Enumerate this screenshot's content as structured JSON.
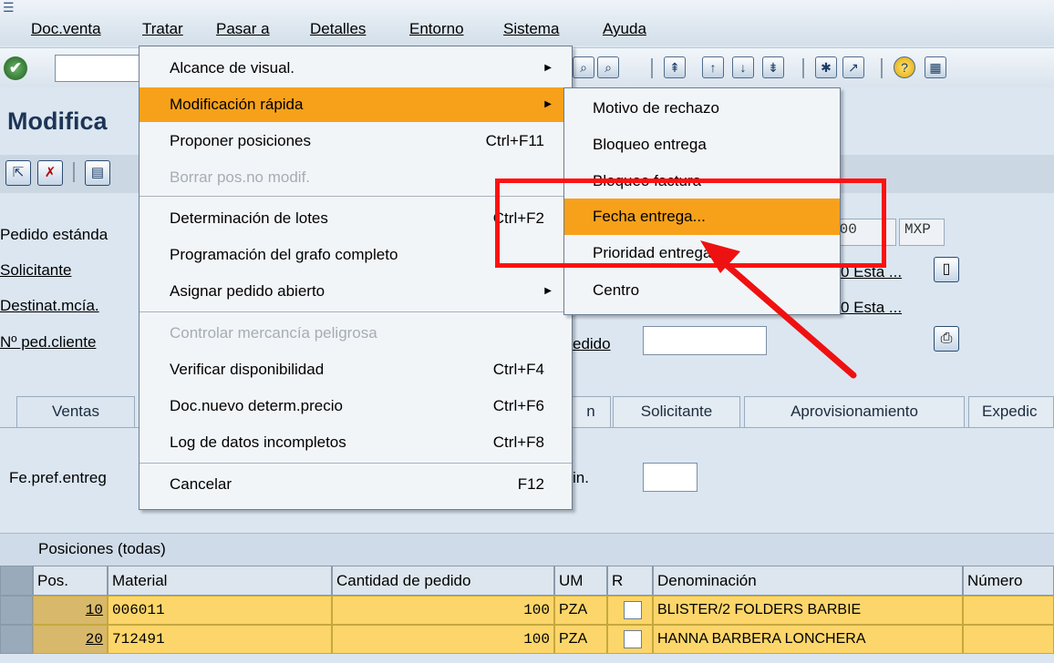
{
  "menubar": {
    "items": [
      "Doc.venta",
      "Tratar",
      "Pasar a",
      "Detalles",
      "Entorno",
      "Sistema",
      "Ayuda"
    ]
  },
  "title": "Modifica",
  "header": {
    "fields": [
      {
        "label": "Pedido estánda",
        "link": false
      },
      {
        "label": "Solicitante",
        "link": true
      },
      {
        "label": "Destinat.mcía.",
        "link": true
      },
      {
        "label": "Nº ped.cliente",
        "link": true
      }
    ],
    "net_value_frag": ".00",
    "currency": "MXP",
    "esta_1": "0 Esta ...",
    "esta_2": "0 Esta ...",
    "fecha_pedido_frag": "edido"
  },
  "tabs": [
    "Ventas",
    "n",
    "Solicitante",
    "Aprovisionamiento",
    "Expedic"
  ],
  "tab_panel": {
    "fe_pref_label": "Fe.pref.entreg",
    "in_label": "in."
  },
  "items": {
    "title": "Posiciones (todas)",
    "columns": [
      "Pos.",
      "Material",
      "Cantidad de pedido",
      "UM",
      "R",
      "Denominación",
      "Número"
    ],
    "rows": [
      {
        "pos": "10",
        "material": "006011",
        "qty": "100",
        "um": "PZA",
        "desc": "BLISTER/2 FOLDERS BARBIE"
      },
      {
        "pos": "20",
        "material": "712491",
        "qty": "100",
        "um": "PZA",
        "desc": "HANNA BARBERA LONCHERA"
      }
    ]
  },
  "menu_tratar": {
    "items": [
      {
        "label": "Alcance de visual.",
        "shortcut": "",
        "submenu": true
      },
      {
        "label": "Modificación rápida",
        "shortcut": "",
        "submenu": true
      },
      {
        "label": "Proponer posiciones",
        "shortcut": "Ctrl+F11",
        "submenu": false
      },
      {
        "label": "Borrar pos.no modif.",
        "shortcut": "",
        "submenu": false
      },
      {
        "label": "Determinación de lotes",
        "shortcut": "Ctrl+F2",
        "submenu": false
      },
      {
        "label": "Programación del grafo completo",
        "shortcut": "",
        "submenu": false
      },
      {
        "label": "Asignar pedido abierto",
        "shortcut": "",
        "submenu": true
      },
      {
        "label": "Controlar mercancía peligrosa",
        "shortcut": "",
        "submenu": false
      },
      {
        "label": "Verificar disponibilidad",
        "shortcut": "Ctrl+F4",
        "submenu": false
      },
      {
        "label": "Doc.nuevo determ.precio",
        "shortcut": "Ctrl+F6",
        "submenu": false
      },
      {
        "label": "Log de datos incompletos",
        "shortcut": "Ctrl+F8",
        "submenu": false
      },
      {
        "label": "Cancelar",
        "shortcut": "F12",
        "submenu": false
      }
    ]
  },
  "submenu_modificacion": {
    "items": [
      "Motivo de rechazo",
      "Bloqueo entrega",
      "Bloqueo factura",
      "Fecha entrega...",
      "Prioridad entrega",
      "Centro"
    ]
  },
  "colors": {
    "highlight": "#f7a11b",
    "annotation": "#ff1111"
  }
}
